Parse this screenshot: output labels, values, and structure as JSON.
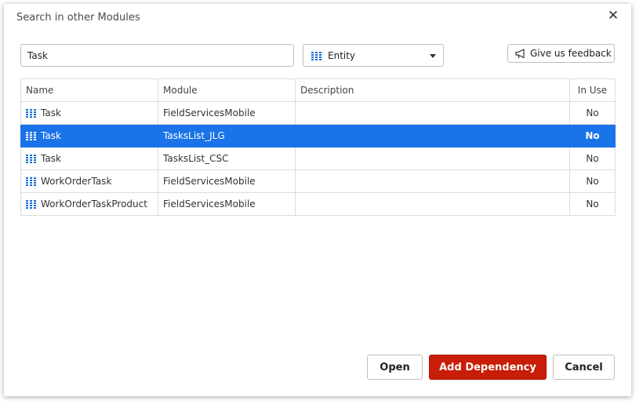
{
  "dialog": {
    "title": "Search in other Modules",
    "close_icon": "close-icon"
  },
  "search": {
    "value": "Task",
    "placeholder": ""
  },
  "type_filter": {
    "selected": "Entity",
    "icon": "entity-icon"
  },
  "feedback": {
    "label": "Give us feedback",
    "icon": "megaphone-icon"
  },
  "table": {
    "headers": {
      "name": "Name",
      "module": "Module",
      "description": "Description",
      "in_use": "In Use"
    },
    "rows": [
      {
        "name": "Task",
        "module": "FieldServicesMobile",
        "description": "",
        "in_use": "No",
        "selected": false
      },
      {
        "name": "Task",
        "module": "TasksList_JLG",
        "description": "",
        "in_use": "No",
        "selected": true
      },
      {
        "name": "Task",
        "module": "TasksList_CSC",
        "description": "",
        "in_use": "No",
        "selected": false
      },
      {
        "name": "WorkOrderTask",
        "module": "FieldServicesMobile",
        "description": "",
        "in_use": "No",
        "selected": false
      },
      {
        "name": "WorkOrderTaskProduct",
        "module": "FieldServicesMobile",
        "description": "",
        "in_use": "No",
        "selected": false
      }
    ]
  },
  "actions": {
    "open": "Open",
    "add_dependency": "Add Dependency",
    "cancel": "Cancel"
  },
  "colors": {
    "selection": "#1a73e8",
    "primary_button": "#c81d06",
    "entity_icon": "#1a6fd6"
  }
}
